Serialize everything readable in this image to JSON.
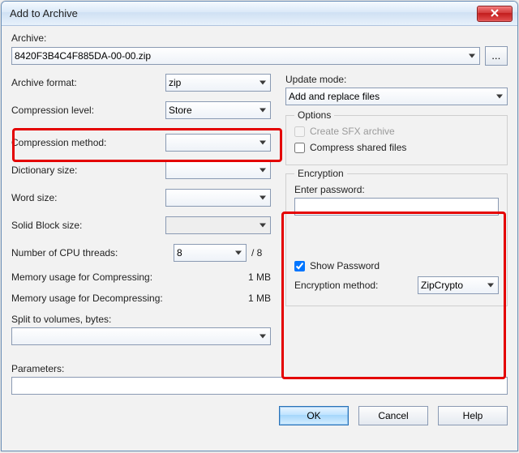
{
  "title": "Add to Archive",
  "archive_label": "Archive:",
  "archive_value": "8420F3B4C4F885DA-00-00.zip",
  "browse": "...",
  "left": {
    "format_label": "Archive format:",
    "format_value": "zip",
    "level_label": "Compression level:",
    "level_value": "Store",
    "method_label": "Compression method:",
    "method_value": "",
    "dict_label": "Dictionary size:",
    "dict_value": "",
    "word_label": "Word size:",
    "word_value": "",
    "solid_label": "Solid Block size:",
    "solid_value": "",
    "threads_label": "Number of CPU threads:",
    "threads_value": "8",
    "threads_total": "/ 8",
    "mem_compress_label": "Memory usage for Compressing:",
    "mem_compress_value": "1 MB",
    "mem_decompress_label": "Memory usage for Decompressing:",
    "mem_decompress_value": "1 MB",
    "split_label": "Split to volumes, bytes:",
    "split_value": ""
  },
  "right": {
    "update_label": "Update mode:",
    "update_value": "Add and replace files",
    "options_title": "Options",
    "sfx_label": "Create SFX archive",
    "shared_label": "Compress shared files",
    "encryption_title": "Encryption",
    "enterpw_label": "Enter password:",
    "password_value": "",
    "showpw_label": "Show Password",
    "enc_method_label": "Encryption method:",
    "enc_method_value": "ZipCrypto"
  },
  "params_label": "Parameters:",
  "params_value": "",
  "buttons": {
    "ok": "OK",
    "cancel": "Cancel",
    "help": "Help"
  }
}
